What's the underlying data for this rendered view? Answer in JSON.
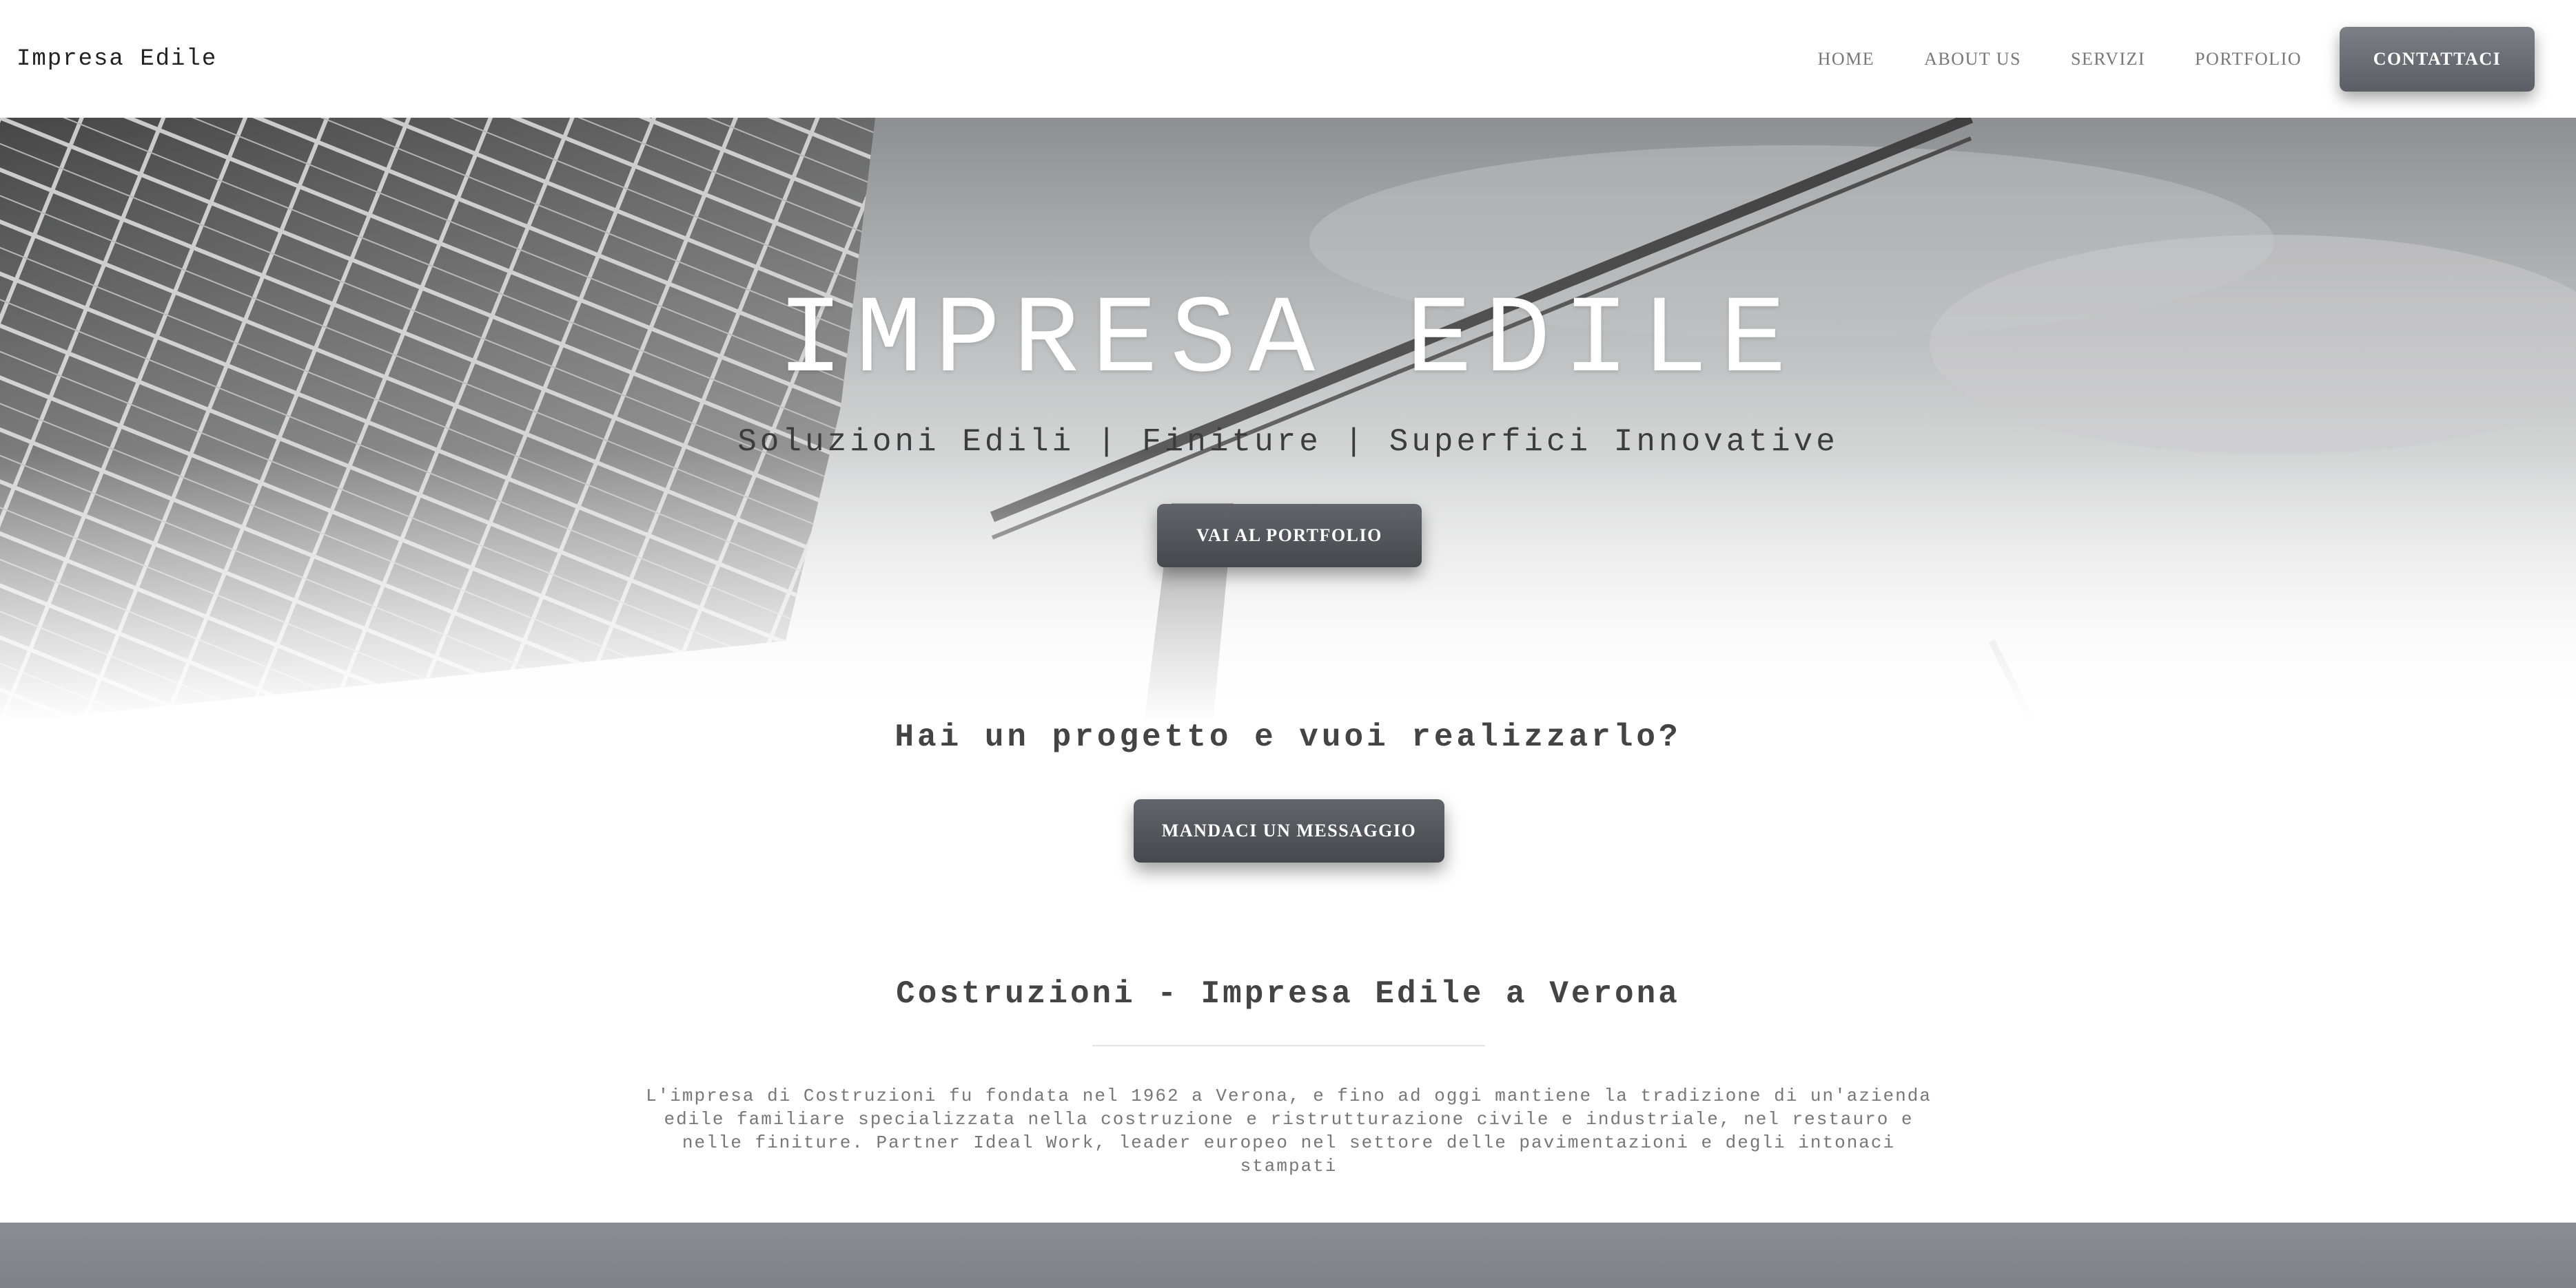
{
  "brand": {
    "name": "Impresa Edile"
  },
  "nav": {
    "items": [
      {
        "label": "HOME"
      },
      {
        "label": "ABOUT US"
      },
      {
        "label": "SERVIZI"
      },
      {
        "label": "PORTFOLIO"
      }
    ],
    "cta_label": "CONTATTACI"
  },
  "hero": {
    "title": "IMPRESA EDILE",
    "subtitle": "Soluzioni Edili | Finiture | Superfici Innovative",
    "button_label": "VAI AL PORTFOLIO"
  },
  "cta": {
    "heading": "Hai un progetto e vuoi realizzarlo?",
    "button_label": "MANDACI UN MESSAGGIO"
  },
  "about": {
    "title": "Costruzioni - Impresa Edile a Verona",
    "text": "L'impresa di Costruzioni fu fondata nel 1962 a Verona, e fino ad oggi mantiene la tradizione di un'azienda edile familiare specializzata nella costruzione e ristrutturazione civile e industriale, nel restauro e nelle finiture. Partner Ideal Work, leader europeo nel settore delle pavimentazioni e degli intonaci stampati"
  },
  "colors": {
    "button": "#4f5257",
    "footer": "#84878c"
  }
}
